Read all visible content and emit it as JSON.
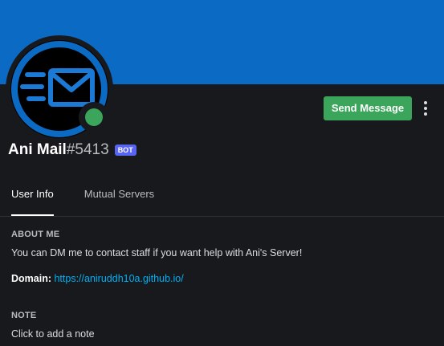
{
  "profile": {
    "username": "Ani Mail",
    "discriminator": "#5413",
    "badge": "BOT",
    "status": "online"
  },
  "actions": {
    "send_message_label": "Send Message"
  },
  "tabs": [
    {
      "label": "User Info",
      "active": true
    },
    {
      "label": "Mutual Servers",
      "active": false
    }
  ],
  "about": {
    "heading": "ABOUT ME",
    "text": "You can DM me to contact staff if you want help with Ani's Server!",
    "domain_label": "Domain:",
    "domain_url": "https://aniruddh10a.github.io/"
  },
  "note": {
    "heading": "NOTE",
    "placeholder": "Click to add a note"
  },
  "colors": {
    "banner": "#0a6ac4",
    "background": "#18191c",
    "send_button": "#3ba55c",
    "online_status": "#3ba55c",
    "bot_badge": "#5865f2",
    "link": "#00aff4"
  },
  "icons": {
    "avatar": "mail-envelope-icon",
    "more": "more-vertical-icon",
    "status": "online-status-icon"
  }
}
